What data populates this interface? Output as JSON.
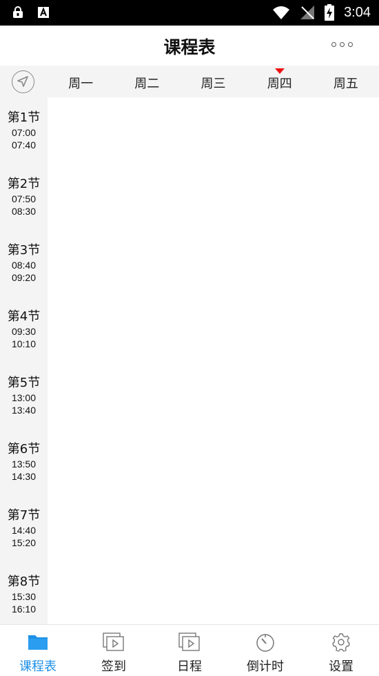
{
  "status_bar": {
    "time": "3:04"
  },
  "header": {
    "title": "课程表",
    "more_icon": "more-dots-icon"
  },
  "week": {
    "days": [
      "周一",
      "周二",
      "周三",
      "周四",
      "周五"
    ],
    "current_day_index": 3,
    "today_marker_color": "#ee1111"
  },
  "periods": [
    {
      "name": "第1节",
      "start": "07:00",
      "end": "07:40"
    },
    {
      "name": "第2节",
      "start": "07:50",
      "end": "08:30"
    },
    {
      "name": "第3节",
      "start": "08:40",
      "end": "09:20"
    },
    {
      "name": "第4节",
      "start": "09:30",
      "end": "10:10"
    },
    {
      "name": "第5节",
      "start": "13:00",
      "end": "13:40"
    },
    {
      "name": "第6节",
      "start": "13:50",
      "end": "14:30"
    },
    {
      "name": "第7节",
      "start": "14:40",
      "end": "15:20"
    },
    {
      "name": "第8节",
      "start": "15:30",
      "end": "16:10"
    }
  ],
  "bottom_nav": {
    "items": [
      {
        "label": "课程表",
        "icon": "folder-icon",
        "active": true
      },
      {
        "label": "签到",
        "icon": "play-card-icon",
        "active": false
      },
      {
        "label": "日程",
        "icon": "play-card-icon",
        "active": false
      },
      {
        "label": "倒计时",
        "icon": "timer-icon",
        "active": false
      },
      {
        "label": "设置",
        "icon": "gear-icon",
        "active": false
      }
    ],
    "active_color": "#1e90e6"
  }
}
